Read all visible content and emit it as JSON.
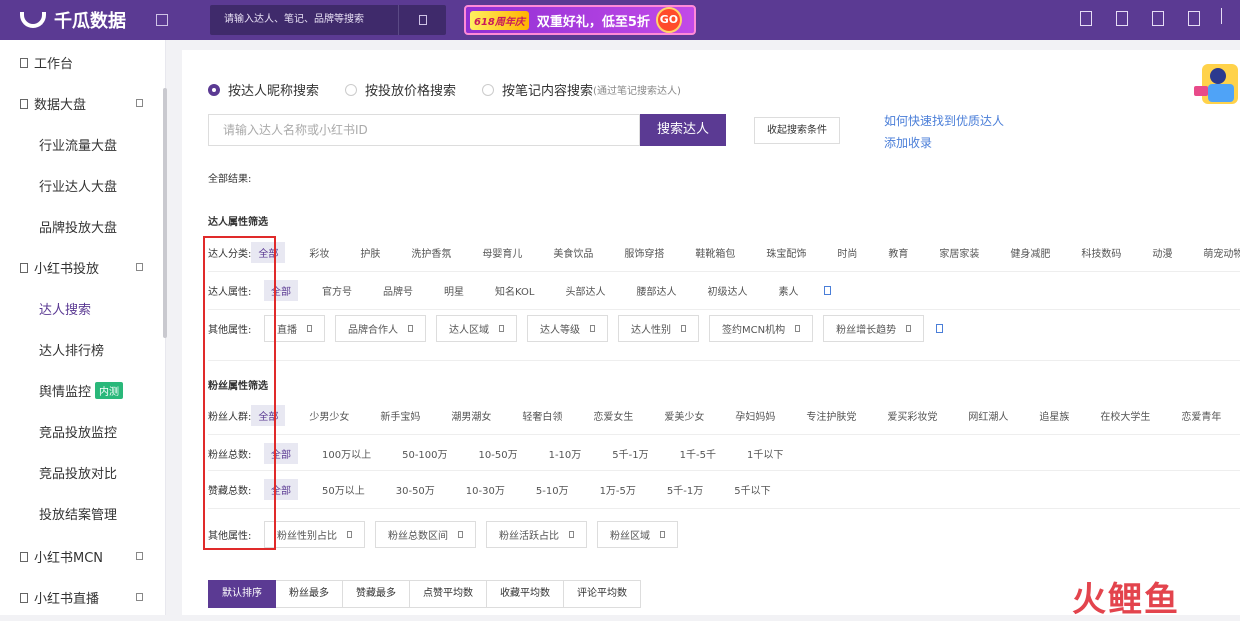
{
  "header": {
    "logo": "千瓜数据",
    "search_placeholder": "请输入达人、笔记、品牌等搜索",
    "promo_badge": "618周年庆",
    "promo_text": "双重好礼，低至5折",
    "promo_go": "GO"
  },
  "sidebar": {
    "items": [
      {
        "label": "工作台",
        "level": "top"
      },
      {
        "label": "数据大盘",
        "level": "top"
      },
      {
        "label": "行业流量大盘",
        "level": "sub"
      },
      {
        "label": "行业达人大盘",
        "level": "sub"
      },
      {
        "label": "品牌投放大盘",
        "level": "sub"
      },
      {
        "label": "小红书投放",
        "level": "top"
      },
      {
        "label": "达人搜索",
        "level": "sub"
      },
      {
        "label": "达人排行榜",
        "level": "sub"
      },
      {
        "label": "舆情监控",
        "level": "sub",
        "badge": "内测"
      },
      {
        "label": "竞品投放监控",
        "level": "sub"
      },
      {
        "label": "竞品投放对比",
        "level": "sub"
      },
      {
        "label": "投放结案管理",
        "level": "sub"
      },
      {
        "label": "小红书MCN",
        "level": "top"
      },
      {
        "label": "小红书直播",
        "level": "top"
      }
    ]
  },
  "main": {
    "radios": [
      {
        "label": "按达人昵称搜索",
        "checked": true
      },
      {
        "label": "按投放价格搜索",
        "checked": false
      },
      {
        "label": "按笔记内容搜索",
        "note": "(通过笔记搜索达人)",
        "checked": false
      }
    ],
    "search_placeholder": "请输入达人名称或小红书ID",
    "search_button": "搜索达人",
    "collapse_button": "收起搜索条件",
    "help_link_1": "如何快速找到优质达人",
    "help_link_2": "添加收录",
    "all_results": "全部结果:",
    "influencer_section": "达人属性筛选",
    "fans_section": "粉丝属性筛选",
    "rows": {
      "category": {
        "label": "达人分类:",
        "options": [
          "全部",
          "彩妆",
          "护肤",
          "洗护香氛",
          "母婴育儿",
          "美食饮品",
          "服饰穿搭",
          "鞋靴箱包",
          "珠宝配饰",
          "时尚",
          "教育",
          "家居家装",
          "健身减肥",
          "科技数码",
          "动漫",
          "萌宠动物"
        ]
      },
      "attribute": {
        "label": "达人属性:",
        "options": [
          "全部",
          "官方号",
          "品牌号",
          "明星",
          "知名KOL",
          "头部达人",
          "腰部达人",
          "初级达人",
          "素人"
        ]
      },
      "other": {
        "label": "其他属性:",
        "dropdowns": [
          "直播",
          "品牌合作人",
          "达人区域",
          "达人等级",
          "达人性别",
          "签约MCN机构",
          "粉丝增长趋势"
        ]
      },
      "fans_group": {
        "label": "粉丝人群:",
        "options": [
          "全部",
          "少男少女",
          "新手宝妈",
          "潮男潮女",
          "轻奢白领",
          "恋爱女生",
          "爱美少女",
          "孕妇妈妈",
          "专注护肤党",
          "爱买彩妆党",
          "网红潮人",
          "追星族",
          "在校大学生",
          "恋爱青年"
        ]
      },
      "fans_total": {
        "label": "粉丝总数:",
        "options": [
          "全部",
          "100万以上",
          "50-100万",
          "10-50万",
          "1-10万",
          "5千-1万",
          "1千-5千",
          "1千以下"
        ]
      },
      "likes_total": {
        "label": "赞藏总数:",
        "options": [
          "全部",
          "50万以上",
          "30-50万",
          "10-30万",
          "5-10万",
          "1万-5万",
          "5千-1万",
          "5千以下"
        ]
      },
      "fans_other": {
        "label": "其他属性:",
        "dropdowns": [
          "粉丝性别占比",
          "粉丝总数区间",
          "粉丝活跃占比",
          "粉丝区域"
        ]
      }
    },
    "sort": [
      "默认排序",
      "粉丝最多",
      "赞藏最多",
      "点赞平均数",
      "收藏平均数",
      "评论平均数"
    ],
    "watermark": "火鲤鱼"
  },
  "colors": {
    "brand": "#5b3a93",
    "highlight": "#e02a2a",
    "link": "#4a7ed8"
  }
}
